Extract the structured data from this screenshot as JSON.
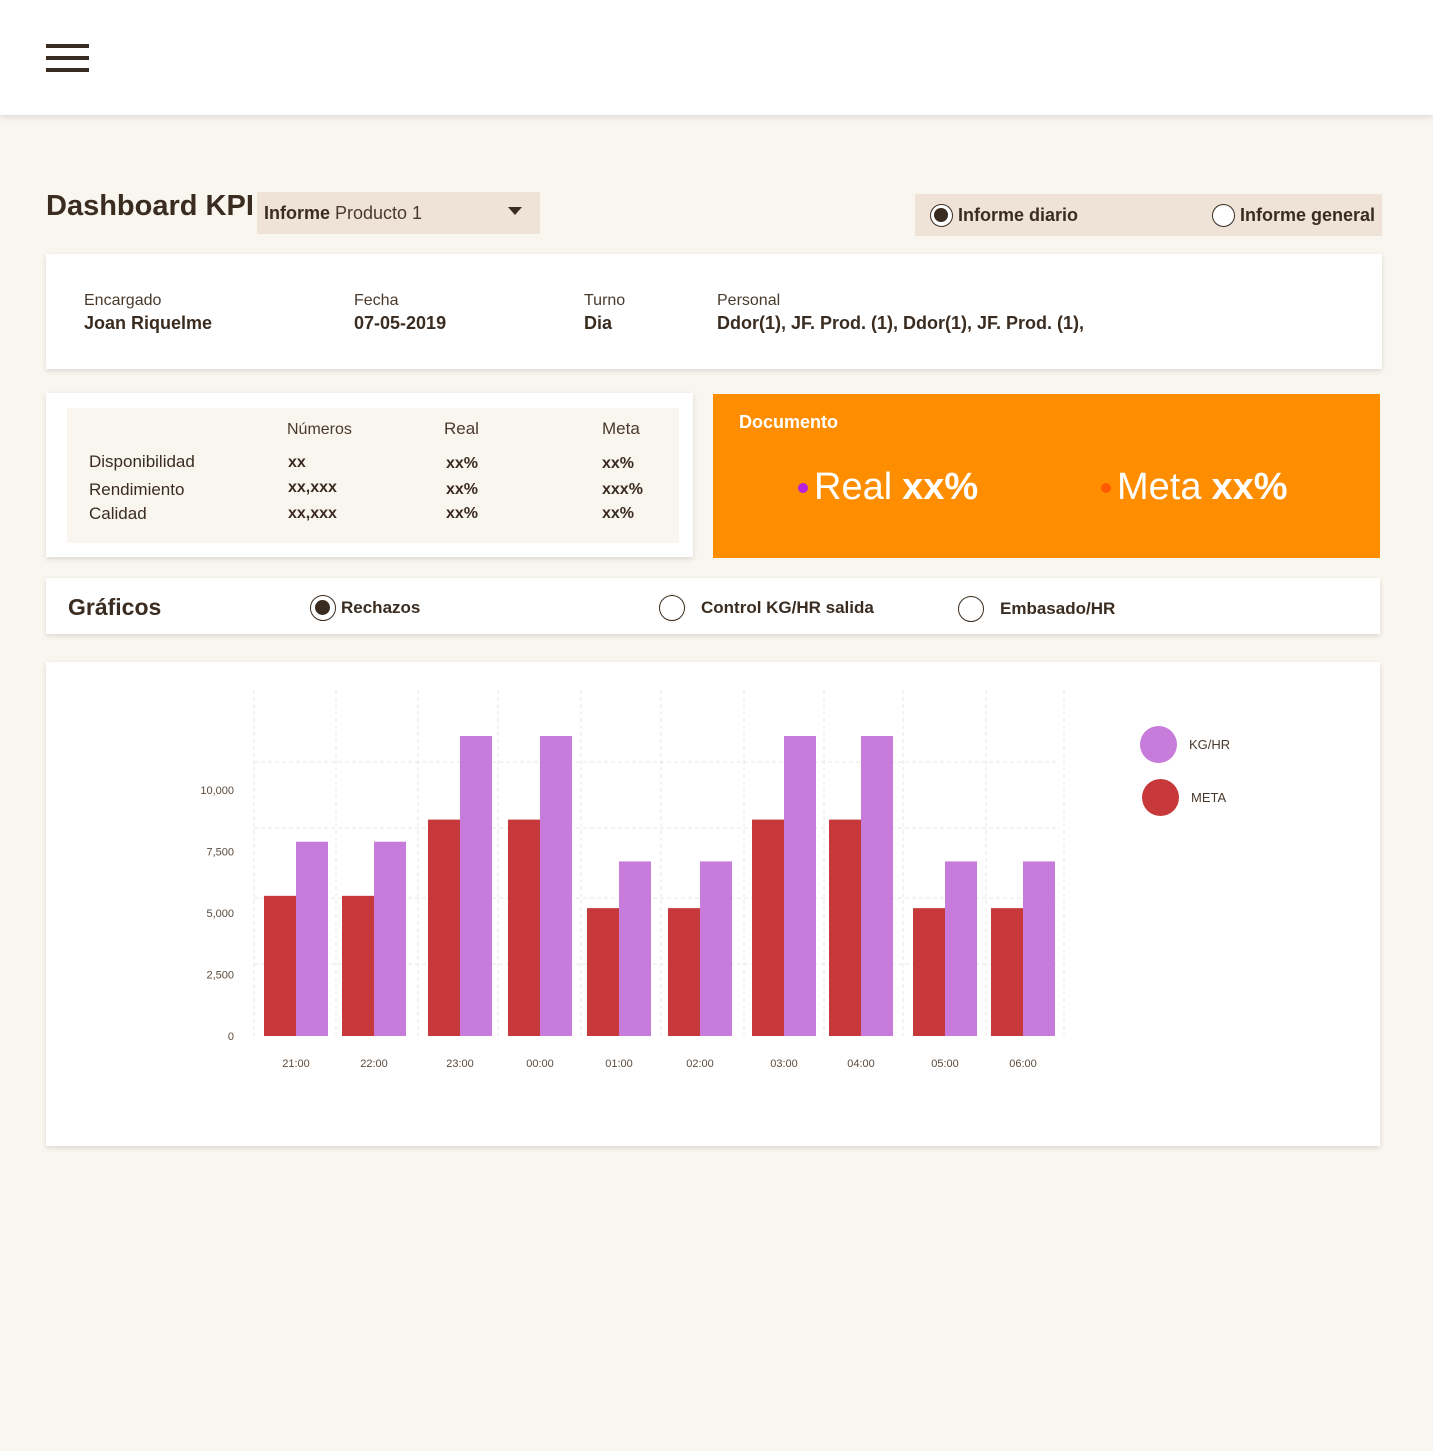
{
  "header": {
    "menu_icon": "hamburger-menu-icon"
  },
  "title": "Dashboard KPI",
  "report_select": {
    "bold_label": "Informe",
    "value": "Producto 1"
  },
  "report_toggle": [
    {
      "label": "Informe diario",
      "checked": true
    },
    {
      "label": "Informe general",
      "checked": false
    }
  ],
  "info": {
    "encargado": {
      "label": "Encargado",
      "value": "Joan Riquelme"
    },
    "fecha": {
      "label": "Fecha",
      "value": "07-05-2019"
    },
    "turno": {
      "label": "Turno",
      "value": "Dia"
    },
    "personal": {
      "label": "Personal",
      "value": "Ddor(1), JF. Prod. (1), Ddor(1), JF. Prod. (1),"
    }
  },
  "kpi_table": {
    "headers": [
      "Números",
      "Real",
      "Meta"
    ],
    "rows": [
      {
        "label": "Disponibilidad",
        "numeros": "xx",
        "real": "xx%",
        "meta": "xx%"
      },
      {
        "label": "Rendimiento",
        "numeros": "xx,xxx",
        "real": "xx%",
        "meta": "xxx%"
      },
      {
        "label": "Calidad",
        "numeros": "xx,xxx",
        "real": "xx%",
        "meta": "xx%"
      }
    ]
  },
  "documento": {
    "title": "Documento",
    "real_label": "Real",
    "real_value": "xx%",
    "meta_label": "Meta",
    "meta_value": "xx%",
    "colors": {
      "background": "#ff8d00",
      "real_dot": "#b620e0",
      "meta_dot": "#ff5a00"
    }
  },
  "graficos": {
    "title": "Gráficos",
    "options": [
      {
        "label": "Rechazos",
        "checked": true
      },
      {
        "label": "Control KG/HR salida",
        "checked": false
      },
      {
        "label": "Embasado/HR",
        "checked": false
      }
    ]
  },
  "chart_data": {
    "type": "bar",
    "categories": [
      "21:00",
      "22:00",
      "23:00",
      "00:00",
      "01:00",
      "02:00",
      "03:00",
      "04:00",
      "05:00",
      "06:00"
    ],
    "series": [
      {
        "name": "META",
        "color": "#c6383a",
        "values": [
          5700,
          5700,
          8800,
          8800,
          5200,
          5200,
          8800,
          8800,
          5200,
          5200
        ]
      },
      {
        "name": "KG/HR",
        "color": "#c77cdb",
        "values": [
          7900,
          7900,
          12200,
          12200,
          7100,
          7100,
          12200,
          12200,
          7100,
          7100
        ]
      }
    ],
    "y_ticks": [
      "0",
      "2,500",
      "5,000",
      "7,500",
      "10,000"
    ],
    "legend_placement": "right",
    "grid": true
  }
}
